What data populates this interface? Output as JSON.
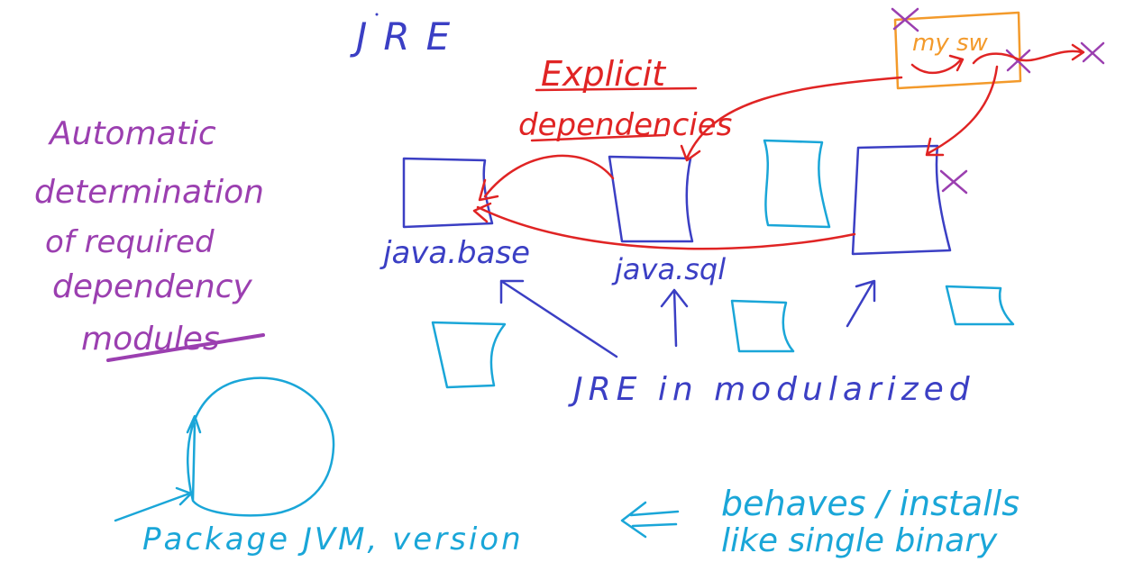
{
  "labels": {
    "jre_title": "JRE",
    "explicit_line1": "Explicit",
    "explicit_line2": "dependencies",
    "my_sw": "my sw",
    "java_base": "java.base",
    "java_sql": "java.sql",
    "jre_modularized": "JRE in modularized",
    "automatic_1": "Automatic",
    "automatic_2": "determination",
    "automatic_3": "of required",
    "automatic_4": "dependency",
    "automatic_5": "modules",
    "package": "Package JVM, version",
    "behaves_1": "behaves / installs",
    "behaves_2": "like single binary"
  },
  "colors": {
    "blue": "#3b3fc4",
    "cyan": "#1aa6d8",
    "red": "#e02424",
    "purple": "#9b3fb0",
    "orange": "#f39a2b"
  }
}
